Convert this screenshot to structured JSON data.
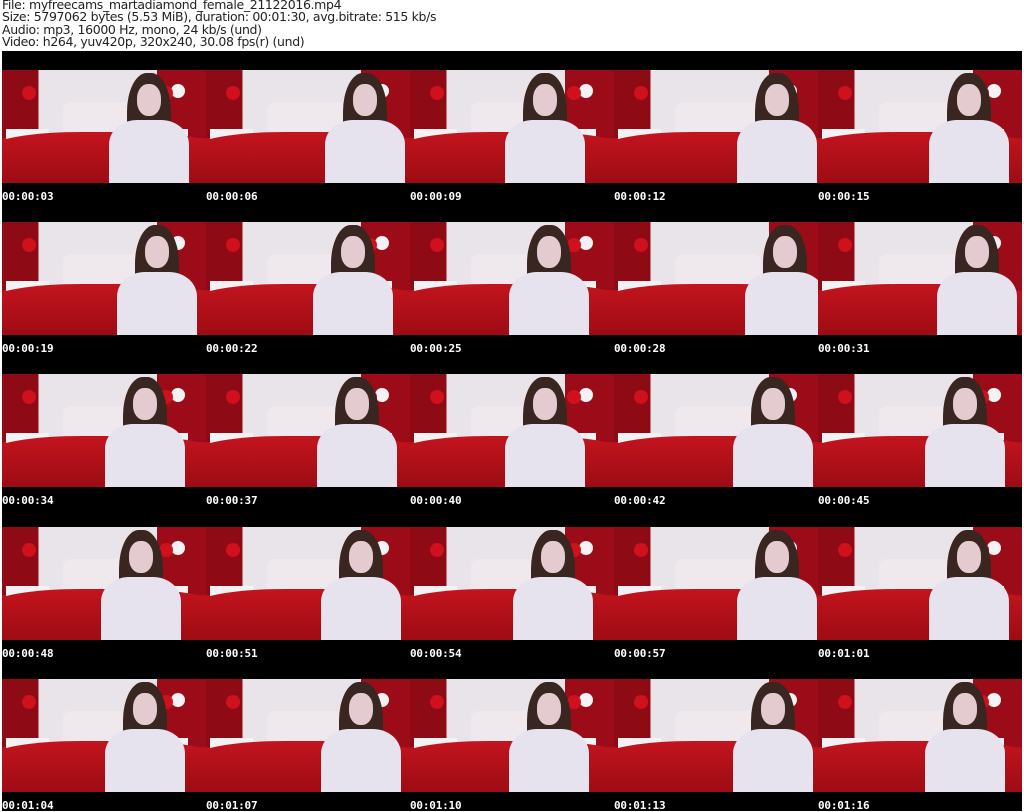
{
  "header": {
    "file": "File: myfreecams_martadiamond_female_21122016.mp4",
    "size": "Size: 5797062 bytes (5.53 MiB), duration: 00:01:30, avg.bitrate: 515 kb/s",
    "audio": "Audio: mp3, 16000 Hz, mono, 24 kb/s (und)",
    "video": "Video: h264, yuv420p, 320x240, 30.08 fps(r) (und)"
  },
  "colors": {
    "background": "#000000",
    "header_bg": "#ffffff",
    "timestamp": "#ffffff"
  },
  "thumbnails": [
    "00:00:03",
    "00:00:06",
    "00:00:09",
    "00:00:12",
    "00:00:15",
    "00:00:19",
    "00:00:22",
    "00:00:25",
    "00:00:28",
    "00:00:31",
    "00:00:34",
    "00:00:37",
    "00:00:40",
    "00:00:42",
    "00:00:45",
    "00:00:48",
    "00:00:51",
    "00:00:54",
    "00:00:57",
    "00:01:01",
    "00:01:04",
    "00:01:07",
    "00:01:10",
    "00:01:13",
    "00:01:16"
  ]
}
